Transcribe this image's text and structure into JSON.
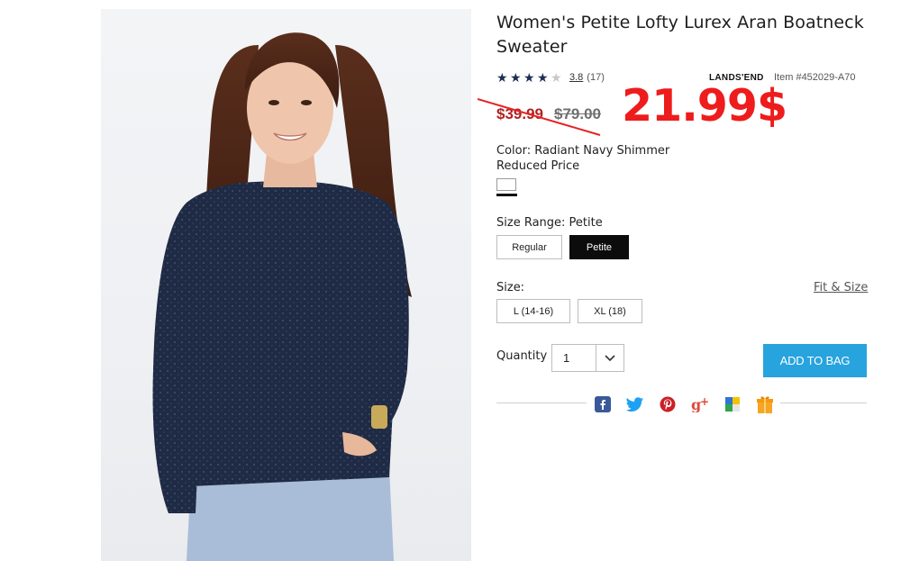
{
  "product": {
    "title": "Women's Petite Lofty Lurex Aran Boatneck Sweater",
    "rating_value": "3.8",
    "review_count": "(17)",
    "rating_stars": 3.8,
    "brand": "LANDS'END",
    "item_number": "Item #452029-A70",
    "sale_price": "$39.99",
    "original_price": "$79.00",
    "promo_price": "21.99$"
  },
  "color": {
    "label": "Color: Radiant Navy Shimmer",
    "note": "Reduced Price",
    "swatch_color": "#ffffff"
  },
  "size_range": {
    "label": "Size Range: Petite",
    "options": [
      "Regular",
      "Petite"
    ],
    "selected": "Petite"
  },
  "size": {
    "label": "Size:",
    "fit_link": "Fit & Size",
    "options": [
      "L (14-16)",
      "XL (18)"
    ]
  },
  "quantity": {
    "label": "Quantity",
    "value": "1"
  },
  "add_to_bag": "ADD TO BAG",
  "share": {
    "icons": [
      "facebook-icon",
      "twitter-icon",
      "pinterest-icon",
      "google-plus-icon",
      "delicious-icon",
      "gift-icon"
    ]
  },
  "colors": {
    "accent": "#27a3de",
    "sale_red": "#b22222",
    "promo_red": "#ee1c1c",
    "star_navy": "#1b2e52"
  }
}
